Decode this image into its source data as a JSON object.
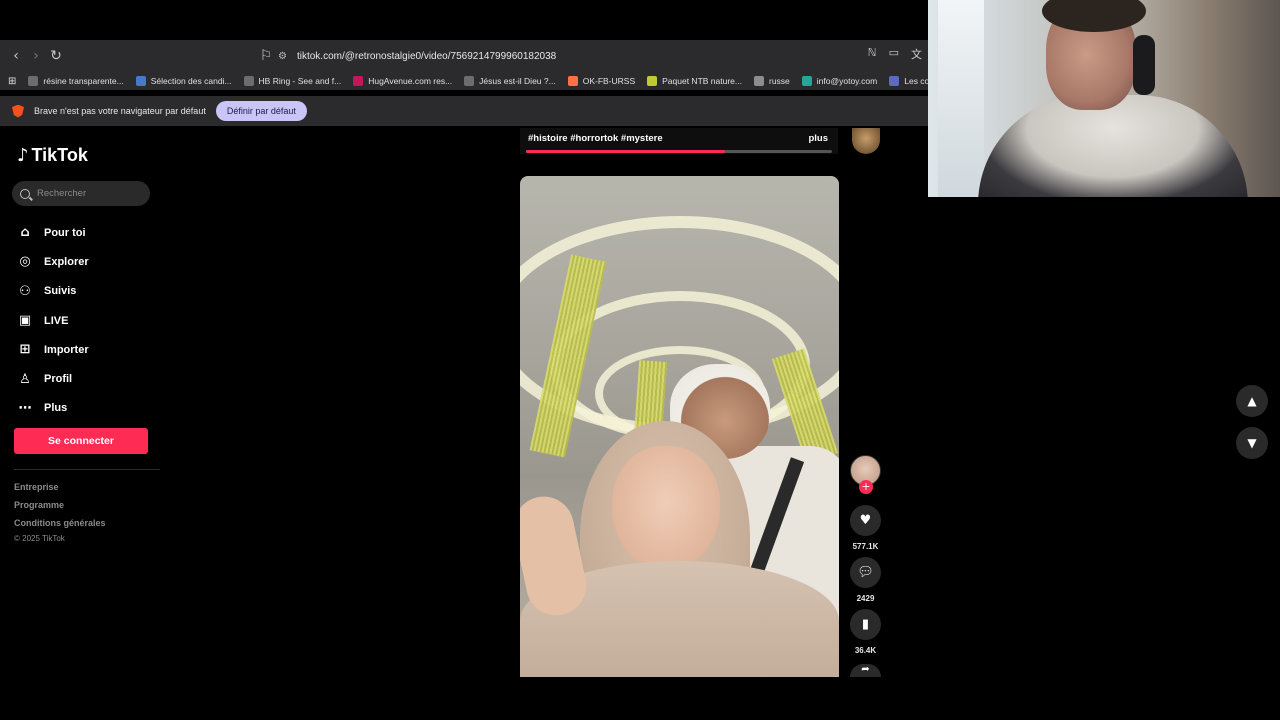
{
  "browser": {
    "url": "tiktok.com/@retronostalgie0/video/7569214799960182038",
    "bookmarks": [
      {
        "label": "résine transparente...",
        "color": "#6d6d6d"
      },
      {
        "label": "Sélection des candi...",
        "color": "#4a78c8"
      },
      {
        "label": "HB Ring - See and f...",
        "color": "#6d6d6d"
      },
      {
        "label": "HugAvenue.com res...",
        "color": "#c2185b"
      },
      {
        "label": "Jésus est-il Dieu ?...",
        "color": "#6d6d6d"
      },
      {
        "label": "OK-FB-URSS",
        "color": "#ff7043"
      },
      {
        "label": "Paquet NTB nature...",
        "color": "#c0ca33"
      },
      {
        "label": "russe",
        "color": "#8d8d8d"
      },
      {
        "label": "info@yotoy.com",
        "color": "#26a69a"
      },
      {
        "label": "Les concours d'a",
        "color": "#5c6bc0"
      }
    ],
    "infobar": {
      "message": "Brave n'est pas votre navigateur par défaut",
      "button": "Définir par défaut"
    }
  },
  "tiktok": {
    "logo": "TikTok",
    "search_placeholder": "Rechercher",
    "nav": [
      {
        "label": "Pour toi",
        "icon": "home-icon",
        "glyph": "⌂"
      },
      {
        "label": "Explorer",
        "icon": "compass-icon",
        "glyph": "◎"
      },
      {
        "label": "Suivis",
        "icon": "following-icon",
        "glyph": "⚇"
      },
      {
        "label": "LIVE",
        "icon": "live-icon",
        "glyph": "▣"
      },
      {
        "label": "Importer",
        "icon": "upload-icon",
        "glyph": "⊞"
      },
      {
        "label": "Profil",
        "icon": "profile-icon",
        "glyph": "♙"
      },
      {
        "label": "Plus",
        "icon": "more-icon",
        "glyph": "⋯"
      }
    ],
    "login_button": "Se connecter",
    "footer": {
      "links": [
        "Entreprise",
        "Programme",
        "Conditions générales"
      ],
      "copyright": "© 2025 TikTok"
    },
    "previous_video": {
      "tags": "#histoire #horrortok #mystere",
      "more": "plus",
      "progress": 0.65
    },
    "actions": {
      "likes": "577.1K",
      "comments": "2429",
      "saves": "36.4K"
    }
  }
}
